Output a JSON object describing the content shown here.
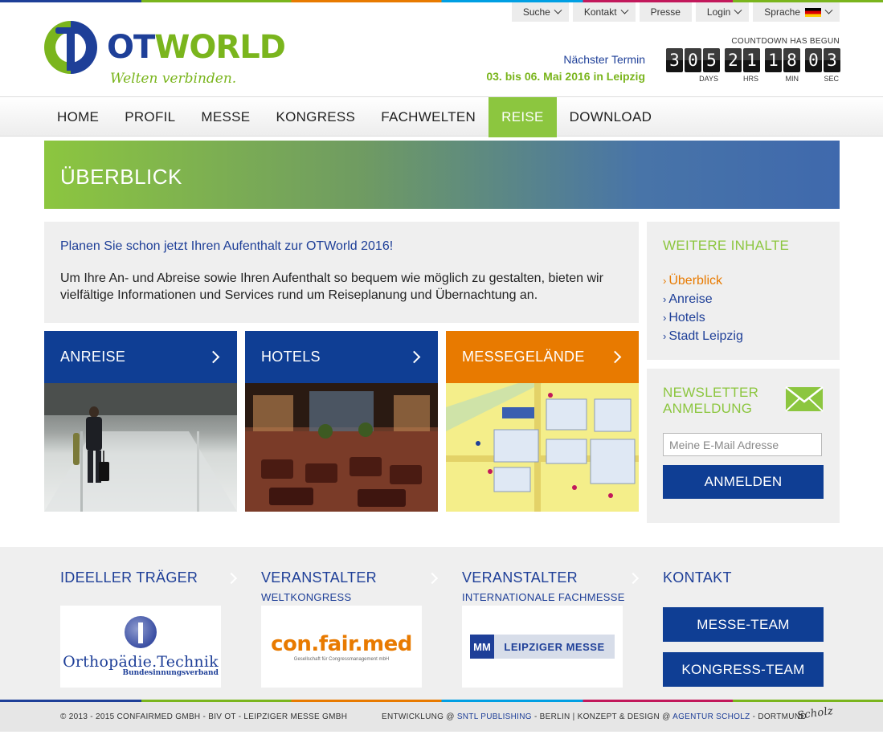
{
  "utility_bar": {
    "items": [
      {
        "label": "Suche"
      },
      {
        "label": "Kontakt"
      },
      {
        "label": "Presse"
      },
      {
        "label": "Login"
      },
      {
        "label": "Sprache"
      }
    ]
  },
  "logo": {
    "ot": "OT",
    "world": "WORLD",
    "tagline": "Welten verbinden."
  },
  "next_event": {
    "title": "Nächster Termin",
    "date": "03. bis 06. Mai 2016 in Leipzig"
  },
  "countdown": {
    "heading": "COUNTDOWN HAS BEGUN",
    "groups": [
      {
        "digits": [
          "3",
          "0",
          "5"
        ],
        "label": "DAYS"
      },
      {
        "digits": [
          "2",
          "1"
        ],
        "label": "HRS"
      },
      {
        "digits": [
          "1",
          "8"
        ],
        "label": "MIN"
      },
      {
        "digits": [
          "0",
          "3"
        ],
        "label": "SEC"
      }
    ]
  },
  "nav": {
    "items": [
      {
        "label": "HOME"
      },
      {
        "label": "PROFIL"
      },
      {
        "label": "MESSE"
      },
      {
        "label": "KONGRESS"
      },
      {
        "label": "FACHWELTEN"
      },
      {
        "label": "REISE",
        "active": true
      },
      {
        "label": "DOWNLOAD"
      }
    ]
  },
  "banner": {
    "title": "ÜBERBLICK"
  },
  "intro": {
    "lead": "Planen Sie schon jetzt Ihren Aufenthalt zur OTWorld 2016!",
    "text": "Um Ihre An- und Abreise sowie Ihren Aufenthalt so bequem wie möglich zu gestalten, bieten wir vielfältige Informationen und Services rund um Reiseplanung und Übernachtung an."
  },
  "tiles": [
    {
      "label": "ANREISE",
      "color": "#0f3e94"
    },
    {
      "label": "HOTELS",
      "color": "#0f3e94"
    },
    {
      "label": "MESSEGELÄNDE",
      "color": "#e87a00"
    }
  ],
  "sidebar": {
    "heading": "WEITERE INHALTE",
    "items": [
      {
        "label": "Überblick",
        "current": true
      },
      {
        "label": "Anreise"
      },
      {
        "label": "Hotels"
      },
      {
        "label": "Stadt Leipzig"
      }
    ]
  },
  "newsletter": {
    "heading_line1": "NEWSLETTER",
    "heading_line2": "ANMELDUNG",
    "placeholder": "Meine E-Mail Adresse",
    "button": "ANMELDEN"
  },
  "footer": {
    "col1": {
      "heading": "IDEELLER TRÄGER",
      "logo_main": "Orthopädie.Technik",
      "logo_sub": "Bundesinnungsverband"
    },
    "col2": {
      "heading": "VERANSTALTER",
      "sub": "WELTKONGRESS",
      "logo_main": "con.fair.med",
      "logo_sub": "Gesellschaft für Congressmanagement mbH"
    },
    "col3": {
      "heading": "VERANSTALTER",
      "sub": "INTERNATIONALE FACHMESSE",
      "logo_main": "LEIPZIGER MESSE"
    },
    "col4": {
      "heading": "KONTAKT",
      "btn1": "MESSE-TEAM",
      "btn2": "KONGRESS-TEAM"
    }
  },
  "copyright": {
    "left": "© 2013 - 2015 CONFAIRMED GMBH - BIV OT - LEIPZIGER MESSE GMBH",
    "right_prefix": "ENTWICKLUNG @ ",
    "right_link1": "SNTL PUBLISHING",
    "right_mid": " - BERLIN | KONZEPT & DESIGN @ ",
    "right_link2": "AGENTUR SCHOLZ",
    "right_suffix": " - DORTMUND",
    "signature": "Scholz"
  },
  "colors": {
    "brand_blue": "#1e3f98",
    "brand_green": "#8cc63f",
    "accent_orange": "#e87a00"
  }
}
